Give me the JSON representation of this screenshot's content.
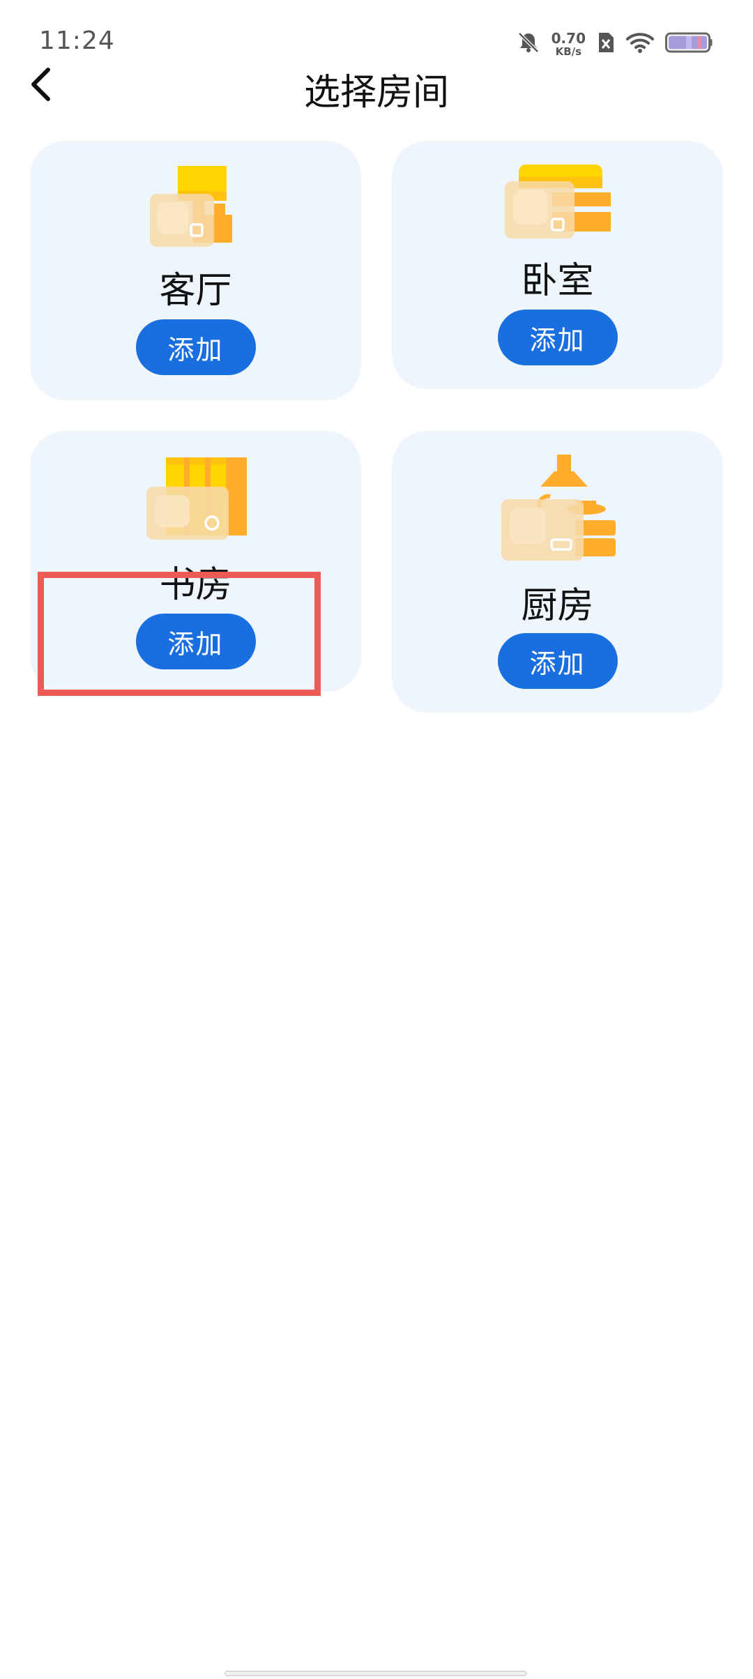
{
  "status_bar": {
    "time": "11:24",
    "net_speed_value": "0.70",
    "net_speed_unit": "KB/s",
    "icons": [
      "bell-muted-icon",
      "sim-off-icon",
      "wifi-icon",
      "battery-icon"
    ]
  },
  "header": {
    "back_icon": "chevron-left-icon",
    "title": "选择房间"
  },
  "rooms": [
    {
      "label": "客厅",
      "button": "添加",
      "icon": "living-room-icon"
    },
    {
      "label": "卧室",
      "button": "添加",
      "icon": "bedroom-icon"
    },
    {
      "label": "书房",
      "button": "添加",
      "icon": "study-room-icon"
    },
    {
      "label": "厨房",
      "button": "添加",
      "icon": "kitchen-icon"
    }
  ],
  "colors": {
    "accent": "#1a6fe0",
    "card_bg": "#eef5fd",
    "icon_orange": "#ffad2a",
    "icon_yellow": "#ffd400",
    "highlight": "#ee5a55"
  }
}
